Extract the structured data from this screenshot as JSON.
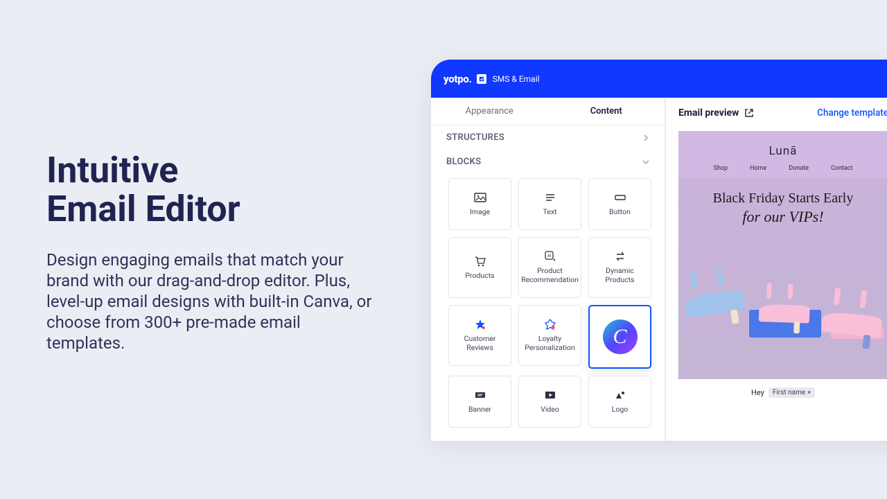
{
  "marketing": {
    "heading_line1": "Intuitive",
    "heading_line2": "Email Editor",
    "body": "Design engaging emails that match your brand with our drag-and-drop editor. Plus, level-up email designs with built-in Canva, or choose from 300+ pre-made email templates."
  },
  "topbar": {
    "brand": "yotpo.",
    "product": "SMS & Email"
  },
  "tabs": {
    "appearance": "Appearance",
    "content": "Content"
  },
  "sections": {
    "structures": "STRUCTURES",
    "blocks": "BLOCKS"
  },
  "blocks": [
    {
      "id": "image",
      "label": "Image"
    },
    {
      "id": "text",
      "label": "Text"
    },
    {
      "id": "button",
      "label": "Button"
    },
    {
      "id": "products",
      "label": "Products"
    },
    {
      "id": "product-recommendation",
      "label": "Product Recommendation"
    },
    {
      "id": "dynamic-products",
      "label": "Dynamic Products"
    },
    {
      "id": "customer-reviews",
      "label": "Customer Reviews"
    },
    {
      "id": "loyalty-personalization",
      "label": "Loyalty Personalization"
    },
    {
      "id": "canva",
      "label": "",
      "selected": true
    },
    {
      "id": "banner",
      "label": "Banner"
    },
    {
      "id": "video",
      "label": "Video"
    },
    {
      "id": "logo",
      "label": "Logo"
    }
  ],
  "preview": {
    "title": "Email preview",
    "change_template": "Change template",
    "brand": "Lunā",
    "nav": [
      "Shop",
      "Home",
      "Donate",
      "Contact"
    ],
    "hero_title": "Black Friday Starts Early",
    "hero_sub": "for our VIPs!",
    "greeting": "Hey",
    "merge_tag": "First name"
  }
}
